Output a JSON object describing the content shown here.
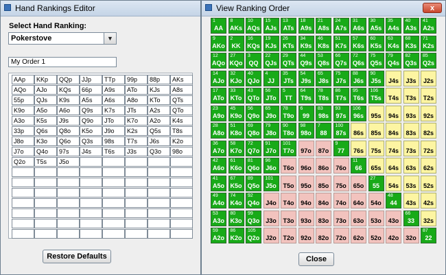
{
  "editor": {
    "title": "Hand Rankings Editor",
    "select_label": "Select Hand Ranking:",
    "ranking_value": "Pokerstove",
    "order_name": "My Order 1",
    "hand_list": [
      [
        "AAp",
        "KKp",
        "QQp",
        "JJp",
        "TTp",
        "99p",
        "88p",
        "AKs"
      ],
      [
        "AQo",
        "AJo",
        "KQs",
        "66p",
        "A9s",
        "ATo",
        "KJs",
        "A8s"
      ],
      [
        "55p",
        "QJs",
        "K9s",
        "A5s",
        "A6s",
        "A8o",
        "KTo",
        "QTs"
      ],
      [
        "K9o",
        "A5o",
        "A6o",
        "Q9s",
        "K7s",
        "JTs",
        "A2s",
        "QTo"
      ],
      [
        "A3o",
        "K5s",
        "J9s",
        "Q9o",
        "JTo",
        "K7o",
        "A2o",
        "K4s"
      ],
      [
        "33p",
        "Q6s",
        "Q8o",
        "K5o",
        "J9o",
        "K2s",
        "Q5s",
        "T8s"
      ],
      [
        "J8o",
        "K3o",
        "Q6o",
        "Q3s",
        "98s",
        "T7s",
        "J6s",
        "K2o"
      ],
      [
        "J7o",
        "Q4o",
        "97s",
        "J4s",
        "T6s",
        "J3s",
        "Q3o",
        "98o"
      ],
      [
        "Q2o",
        "T5s",
        "J5o",
        "",
        "",
        "",
        "",
        ""
      ],
      [
        "",
        "",
        "",
        "",
        "",
        "",
        "",
        ""
      ],
      [
        "",
        "",
        "",
        "",
        "",
        "",
        "",
        ""
      ],
      [
        "",
        "",
        "",
        "",
        "",
        "",
        "",
        ""
      ],
      [
        "",
        "",
        "",
        "",
        "",
        "",
        "",
        ""
      ],
      [
        "",
        "",
        "",
        "",
        "",
        "",
        "",
        ""
      ],
      [
        "",
        "",
        "",
        "",
        "",
        "",
        "",
        ""
      ],
      [
        "",
        "",
        "",
        "",
        "",
        "",
        "",
        ""
      ]
    ],
    "restore_label": "Restore Defaults"
  },
  "ranking_window": {
    "title": "View Ranking Order",
    "close_x": "x",
    "close_label": "Close",
    "colors": {
      "green": "#18aa18",
      "yellow": "#fdf5a2",
      "pink": "#f2c3be"
    },
    "matrix": [
      [
        {
          "r": "1",
          "h": "AA",
          "c": "g"
        },
        {
          "r": "8",
          "h": "AKs",
          "c": "g"
        },
        {
          "r": "10",
          "h": "AQs",
          "c": "g"
        },
        {
          "r": "15",
          "h": "AJs",
          "c": "g"
        },
        {
          "r": "13",
          "h": "ATs",
          "c": "g"
        },
        {
          "r": "18",
          "h": "A9s",
          "c": "g"
        },
        {
          "r": "21",
          "h": "A8s",
          "c": "g"
        },
        {
          "r": "24",
          "h": "A7s",
          "c": "g"
        },
        {
          "r": "31",
          "h": "A6s",
          "c": "g"
        },
        {
          "r": "30",
          "h": "A5s",
          "c": "g"
        },
        {
          "r": "35",
          "h": "A4s",
          "c": "g"
        },
        {
          "r": "40",
          "h": "A3s",
          "c": "g"
        },
        {
          "r": "41",
          "h": "A2s",
          "c": "g"
        }
      ],
      [
        {
          "r": "9",
          "h": "AKo",
          "c": "g"
        },
        {
          "r": "2",
          "h": "KK",
          "c": "g"
        },
        {
          "r": "16",
          "h": "KQs",
          "c": "g"
        },
        {
          "r": "19",
          "h": "KJs",
          "c": "g"
        },
        {
          "r": "26",
          "h": "KTs",
          "c": "g"
        },
        {
          "r": "34",
          "h": "K9s",
          "c": "g"
        },
        {
          "r": "46",
          "h": "K8s",
          "c": "g"
        },
        {
          "r": "51",
          "h": "K7s",
          "c": "g"
        },
        {
          "r": "57",
          "h": "K6s",
          "c": "g"
        },
        {
          "r": "60",
          "h": "K5s",
          "c": "g"
        },
        {
          "r": "63",
          "h": "K4s",
          "c": "g"
        },
        {
          "r": "68",
          "h": "K3s",
          "c": "g"
        },
        {
          "r": "71",
          "h": "K2s",
          "c": "g"
        }
      ],
      [
        {
          "r": "12",
          "h": "AQo",
          "c": "g"
        },
        {
          "r": "27",
          "h": "KQo",
          "c": "g"
        },
        {
          "r": "3",
          "h": "QQ",
          "c": "g"
        },
        {
          "r": "22",
          "h": "QJs",
          "c": "g"
        },
        {
          "r": "29",
          "h": "QTs",
          "c": "g"
        },
        {
          "r": "44",
          "h": "Q9s",
          "c": "g"
        },
        {
          "r": "53",
          "h": "Q8s",
          "c": "g"
        },
        {
          "r": "66",
          "h": "Q7s",
          "c": "g"
        },
        {
          "r": "72",
          "h": "Q6s",
          "c": "g"
        },
        {
          "r": "75",
          "h": "Q5s",
          "c": "g"
        },
        {
          "r": "79",
          "h": "Q4s",
          "c": "g"
        },
        {
          "r": "82",
          "h": "Q3s",
          "c": "g"
        },
        {
          "r": "85",
          "h": "Q2s",
          "c": "g"
        }
      ],
      [
        {
          "r": "14",
          "h": "AJo",
          "c": "g"
        },
        {
          "r": "32",
          "h": "KJo",
          "c": "g"
        },
        {
          "r": "40",
          "h": "QJo",
          "c": "g"
        },
        {
          "r": "4",
          "h": "JJ",
          "c": "g"
        },
        {
          "r": "35",
          "h": "JTs",
          "c": "g"
        },
        {
          "r": "54",
          "h": "J9s",
          "c": "g"
        },
        {
          "r": "65",
          "h": "J8s",
          "c": "g"
        },
        {
          "r": "75",
          "h": "J7s",
          "c": "g"
        },
        {
          "r": "88",
          "h": "J6s",
          "c": "g"
        },
        {
          "r": "90",
          "h": "J5s",
          "c": "g"
        },
        {
          "r": "",
          "h": "J4s",
          "c": "y"
        },
        {
          "r": "",
          "h": "J3s",
          "c": "y"
        },
        {
          "r": "",
          "h": "J2s",
          "c": "y"
        }
      ],
      [
        {
          "r": "17",
          "h": "ATo",
          "c": "g"
        },
        {
          "r": "33",
          "h": "KTo",
          "c": "g"
        },
        {
          "r": "43",
          "h": "QTo",
          "c": "g"
        },
        {
          "r": "56",
          "h": "JTo",
          "c": "g"
        },
        {
          "r": "5",
          "h": "TT",
          "c": "g"
        },
        {
          "r": "64",
          "h": "T9s",
          "c": "g"
        },
        {
          "r": "78",
          "h": "T8s",
          "c": "g"
        },
        {
          "r": "86",
          "h": "T7s",
          "c": "g"
        },
        {
          "r": "95",
          "h": "T6s",
          "c": "g"
        },
        {
          "r": "106",
          "h": "T5s",
          "c": "g"
        },
        {
          "r": "",
          "h": "T4s",
          "c": "y"
        },
        {
          "r": "",
          "h": "T3s",
          "c": "y"
        },
        {
          "r": "",
          "h": "T2s",
          "c": "y"
        }
      ],
      [
        {
          "r": "23",
          "h": "A9o",
          "c": "g"
        },
        {
          "r": "45",
          "h": "K9o",
          "c": "g"
        },
        {
          "r": "56",
          "h": "Q9o",
          "c": "g"
        },
        {
          "r": "65",
          "h": "J9o",
          "c": "g"
        },
        {
          "r": "78",
          "h": "T9o",
          "c": "g"
        },
        {
          "r": "6",
          "h": "99",
          "c": "g"
        },
        {
          "r": "83",
          "h": "98s",
          "c": "g"
        },
        {
          "r": "93",
          "h": "97s",
          "c": "g"
        },
        {
          "r": "106",
          "h": "96s",
          "c": "g"
        },
        {
          "r": "",
          "h": "95s",
          "c": "y"
        },
        {
          "r": "",
          "h": "94s",
          "c": "y"
        },
        {
          "r": "",
          "h": "93s",
          "c": "y"
        },
        {
          "r": "",
          "h": "92s",
          "c": "y"
        }
      ],
      [
        {
          "r": "28",
          "h": "A8o",
          "c": "g"
        },
        {
          "r": "51",
          "h": "K8o",
          "c": "g"
        },
        {
          "r": "69",
          "h": "Q8o",
          "c": "g"
        },
        {
          "r": "79",
          "h": "J8o",
          "c": "g"
        },
        {
          "r": "90",
          "h": "T8o",
          "c": "g"
        },
        {
          "r": "98",
          "h": "98o",
          "c": "g"
        },
        {
          "r": "7",
          "h": "88",
          "c": "g"
        },
        {
          "r": "100",
          "h": "87s",
          "c": "g"
        },
        {
          "r": "",
          "h": "86s",
          "c": "y"
        },
        {
          "r": "",
          "h": "85s",
          "c": "y"
        },
        {
          "r": "",
          "h": "84s",
          "c": "y"
        },
        {
          "r": "",
          "h": "83s",
          "c": "y"
        },
        {
          "r": "",
          "h": "82s",
          "c": "y"
        }
      ],
      [
        {
          "r": "36",
          "h": "A7o",
          "c": "g"
        },
        {
          "r": "58",
          "h": "K7o",
          "c": "g"
        },
        {
          "r": "72",
          "h": "Q7o",
          "c": "g"
        },
        {
          "r": "91",
          "h": "J7o",
          "c": "g"
        },
        {
          "r": "101",
          "h": "T7o",
          "c": "g"
        },
        {
          "r": "",
          "h": "97o",
          "c": "p"
        },
        {
          "r": "",
          "h": "87o",
          "c": "p"
        },
        {
          "r": "9",
          "h": "77",
          "c": "g"
        },
        {
          "r": "",
          "h": "76s",
          "c": "y"
        },
        {
          "r": "",
          "h": "75s",
          "c": "y"
        },
        {
          "r": "",
          "h": "74s",
          "c": "y"
        },
        {
          "r": "",
          "h": "73s",
          "c": "y"
        },
        {
          "r": "",
          "h": "72s",
          "c": "y"
        }
      ],
      [
        {
          "r": "42",
          "h": "A6o",
          "c": "g"
        },
        {
          "r": "61",
          "h": "K6o",
          "c": "g"
        },
        {
          "r": "81",
          "h": "Q6o",
          "c": "g"
        },
        {
          "r": "96",
          "h": "J6o",
          "c": "g"
        },
        {
          "r": "",
          "h": "T6o",
          "c": "p"
        },
        {
          "r": "",
          "h": "96o",
          "c": "p"
        },
        {
          "r": "",
          "h": "86o",
          "c": "p"
        },
        {
          "r": "",
          "h": "76o",
          "c": "p"
        },
        {
          "r": "11",
          "h": "66",
          "c": "g"
        },
        {
          "r": "",
          "h": "65s",
          "c": "y"
        },
        {
          "r": "",
          "h": "64s",
          "c": "y"
        },
        {
          "r": "",
          "h": "63s",
          "c": "y"
        },
        {
          "r": "",
          "h": "62s",
          "c": "y"
        }
      ],
      [
        {
          "r": "41",
          "h": "A5o",
          "c": "g"
        },
        {
          "r": "67",
          "h": "K5o",
          "c": "g"
        },
        {
          "r": "89",
          "h": "Q5o",
          "c": "g"
        },
        {
          "r": "101",
          "h": "J5o",
          "c": "g"
        },
        {
          "r": "",
          "h": "T5o",
          "c": "p"
        },
        {
          "r": "",
          "h": "95o",
          "c": "p"
        },
        {
          "r": "",
          "h": "85o",
          "c": "p"
        },
        {
          "r": "",
          "h": "75o",
          "c": "p"
        },
        {
          "r": "",
          "h": "65o",
          "c": "p"
        },
        {
          "r": "27",
          "h": "55",
          "c": "g"
        },
        {
          "r": "",
          "h": "54s",
          "c": "y"
        },
        {
          "r": "",
          "h": "53s",
          "c": "y"
        },
        {
          "r": "",
          "h": "52s",
          "c": "y"
        }
      ],
      [
        {
          "r": "49",
          "h": "A4o",
          "c": "g"
        },
        {
          "r": "74",
          "h": "K4o",
          "c": "g"
        },
        {
          "r": "92",
          "h": "Q4o",
          "c": "g"
        },
        {
          "r": "",
          "h": "J4o",
          "c": "p"
        },
        {
          "r": "",
          "h": "T4o",
          "c": "p"
        },
        {
          "r": "",
          "h": "94o",
          "c": "p"
        },
        {
          "r": "",
          "h": "84o",
          "c": "p"
        },
        {
          "r": "",
          "h": "74o",
          "c": "p"
        },
        {
          "r": "",
          "h": "64o",
          "c": "p"
        },
        {
          "r": "",
          "h": "54o",
          "c": "p"
        },
        {
          "r": "48",
          "h": "44",
          "c": "g"
        },
        {
          "r": "",
          "h": "43s",
          "c": "y"
        },
        {
          "r": "",
          "h": "42s",
          "c": "y"
        }
      ],
      [
        {
          "r": "53",
          "h": "A3o",
          "c": "g"
        },
        {
          "r": "80",
          "h": "K3o",
          "c": "g"
        },
        {
          "r": "99",
          "h": "Q3o",
          "c": "g"
        },
        {
          "r": "",
          "h": "J3o",
          "c": "p"
        },
        {
          "r": "",
          "h": "T3o",
          "c": "p"
        },
        {
          "r": "",
          "h": "93o",
          "c": "p"
        },
        {
          "r": "",
          "h": "83o",
          "c": "p"
        },
        {
          "r": "",
          "h": "73o",
          "c": "p"
        },
        {
          "r": "",
          "h": "63o",
          "c": "p"
        },
        {
          "r": "",
          "h": "53o",
          "c": "p"
        },
        {
          "r": "",
          "h": "43o",
          "c": "p"
        },
        {
          "r": "66",
          "h": "33",
          "c": "g"
        },
        {
          "r": "",
          "h": "32s",
          "c": "y"
        }
      ],
      [
        {
          "r": "59",
          "h": "A2o",
          "c": "g"
        },
        {
          "r": "86",
          "h": "K2o",
          "c": "g"
        },
        {
          "r": "105",
          "h": "Q2o",
          "c": "g"
        },
        {
          "r": "",
          "h": "J2o",
          "c": "p"
        },
        {
          "r": "",
          "h": "T2o",
          "c": "p"
        },
        {
          "r": "",
          "h": "92o",
          "c": "p"
        },
        {
          "r": "",
          "h": "82o",
          "c": "p"
        },
        {
          "r": "",
          "h": "72o",
          "c": "p"
        },
        {
          "r": "",
          "h": "62o",
          "c": "p"
        },
        {
          "r": "",
          "h": "52o",
          "c": "p"
        },
        {
          "r": "",
          "h": "42o",
          "c": "p"
        },
        {
          "r": "",
          "h": "32o",
          "c": "p"
        },
        {
          "r": "87",
          "h": "22",
          "c": "g"
        }
      ]
    ]
  }
}
